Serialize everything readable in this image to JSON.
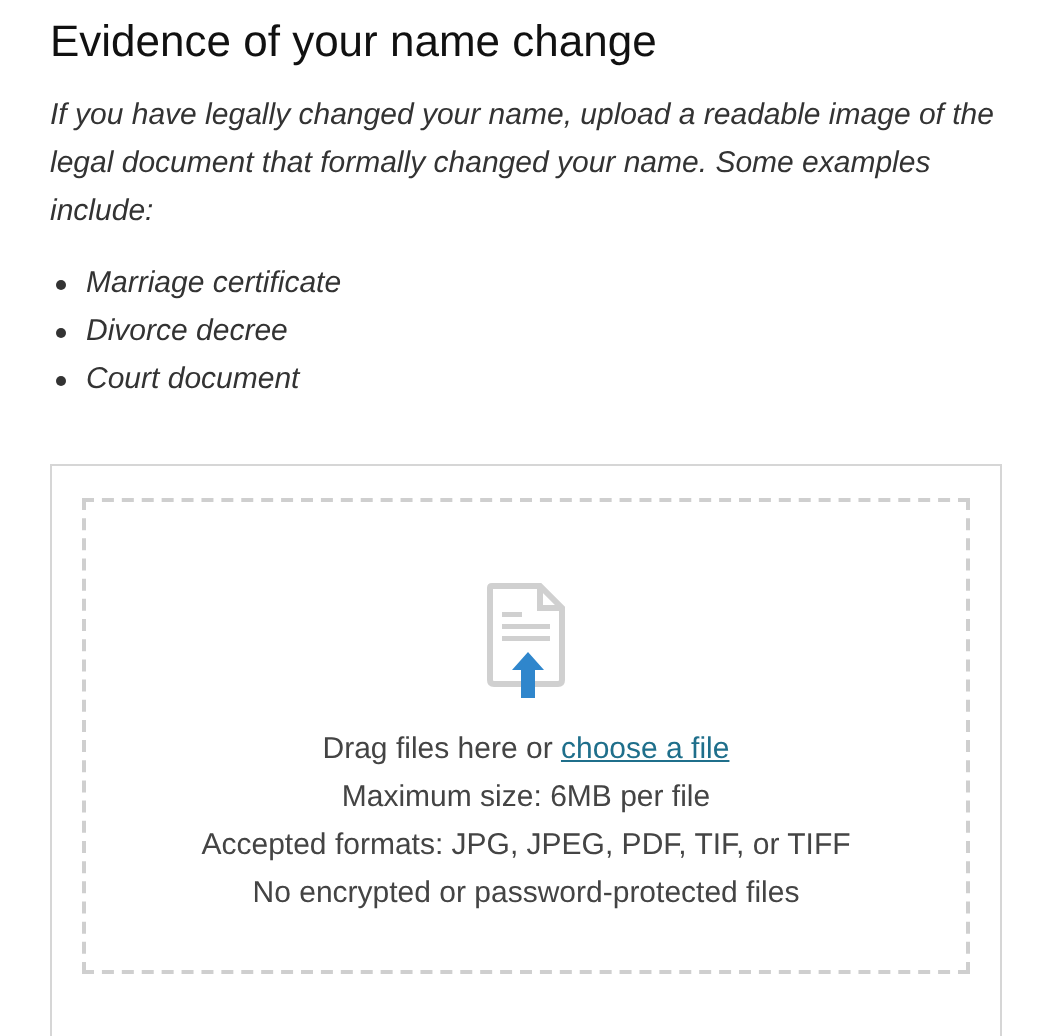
{
  "heading": "Evidence of your name change",
  "intro": "If you have legally changed your name, upload a readable image of the legal document that formally changed your name. Some examples include:",
  "examples": [
    "Marriage certificate",
    "Divorce decree",
    "Court document"
  ],
  "dropzone": {
    "prompt": "Drag files here or",
    "link": "choose a file",
    "notes": [
      "Maximum size: 6MB per file",
      "Accepted formats: JPG, JPEG, PDF, TIF, or TIFF",
      "No encrypted or password-protected files"
    ]
  }
}
